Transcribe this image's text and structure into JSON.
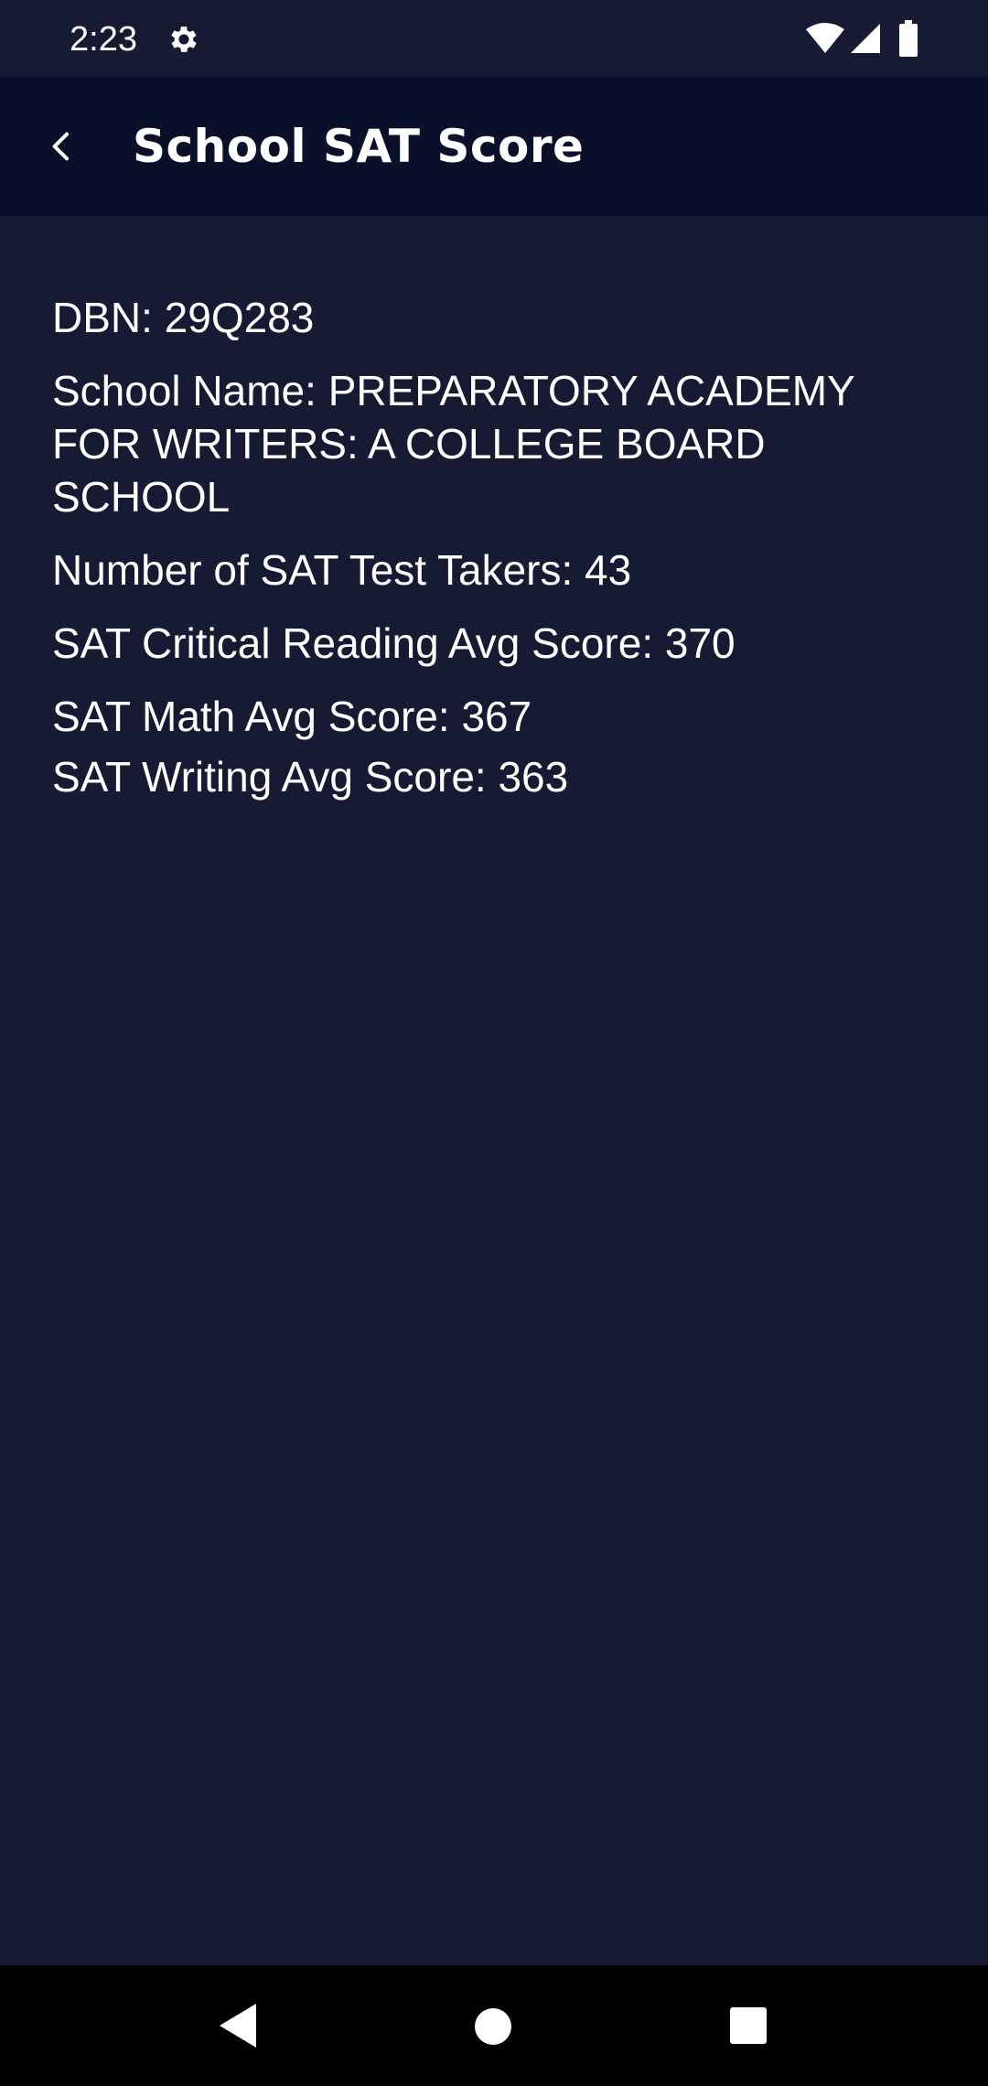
{
  "status_bar": {
    "time": "2:23",
    "icons": [
      "gear-icon",
      "wifi-icon",
      "signal-icon",
      "battery-icon"
    ]
  },
  "app_bar": {
    "title": "School SAT Score",
    "back_icon": "chevron-left-icon"
  },
  "details": {
    "dbn": "DBN: 29Q283",
    "school_name": "School Name: PREPARATORY ACADEMY FOR WRITERS: A COLLEGE BOARD SCHOOL",
    "test_takers": "Number of SAT Test Takers: 43",
    "reading_avg": "SAT Critical Reading Avg Score: 370",
    "math_avg": "SAT Math Avg Score: 367",
    "writing_avg": "SAT Writing Avg Score: 363"
  },
  "nav_bar": {
    "icons": [
      "nav-back-icon",
      "nav-home-icon",
      "nav-recents-icon"
    ]
  },
  "colors": {
    "background": "#161b33",
    "app_bar": "#0a1029",
    "nav_bar": "#000000",
    "text": "#ffffff"
  }
}
